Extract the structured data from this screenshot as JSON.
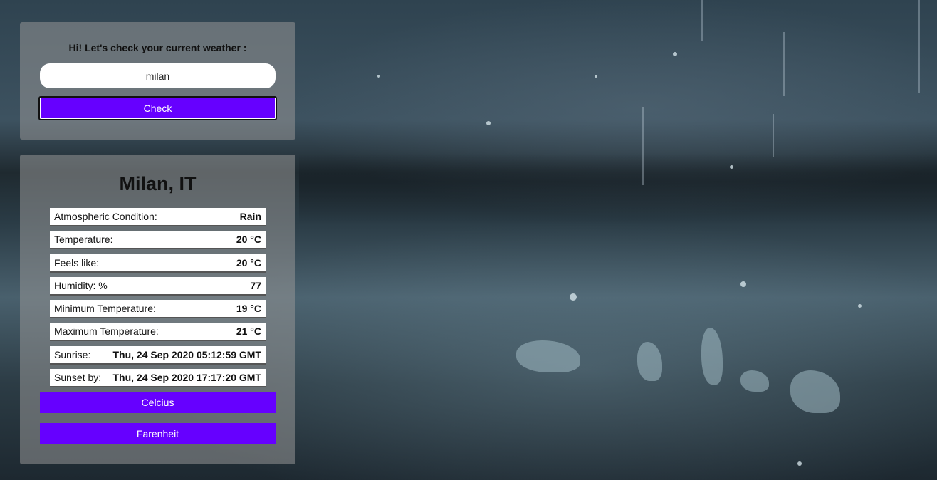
{
  "search": {
    "greeting": "Hi! Let's check your current weather :",
    "city_value": "milan",
    "check_label": "Check"
  },
  "result": {
    "city": "Milan, IT",
    "rows": [
      {
        "label": "Atmospheric Condition:",
        "value": "Rain"
      },
      {
        "label": "Temperature:",
        "value": "20 °C"
      },
      {
        "label": "Feels like:",
        "value": "20 °C"
      },
      {
        "label": "Humidity: %",
        "value": "77"
      },
      {
        "label": "Minimum Temperature:",
        "value": "19 °C"
      },
      {
        "label": "Maximum Temperature:",
        "value": "21 °C"
      },
      {
        "label": "Sunrise:",
        "value": "Thu, 24 Sep 2020 05:12:59 GMT"
      },
      {
        "label": "Sunset by:",
        "value": "Thu, 24 Sep 2020 17:17:20 GMT"
      }
    ],
    "celcius_label": "Celcius",
    "farenheit_label": "Farenheit"
  },
  "colors": {
    "accent": "#6600ff",
    "panel": "#969696"
  }
}
